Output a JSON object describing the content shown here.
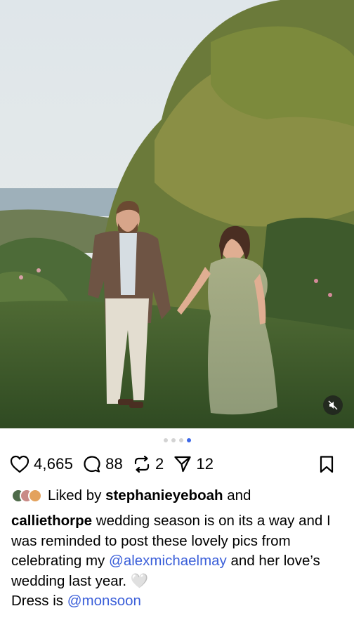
{
  "post": {
    "carousel": {
      "total": 4,
      "active_index": 3
    },
    "media": {
      "mute_icon": "speaker-muted-icon"
    },
    "actions": {
      "likes": "4,665",
      "comments": "88",
      "reposts": "2",
      "shares": "12"
    },
    "liked_by": {
      "prefix": "Liked by",
      "user": "stephanieyeboah",
      "suffix": "and"
    },
    "caption": {
      "username": "calliethorpe",
      "text_1": "wedding season is on its a way and I was reminded to post these lovely pics from celebrating my",
      "mention_1": "@alexmichaelmay",
      "text_2": "and her love’s wedding last year. 🤍",
      "text_3": "Dress is",
      "mention_2": "@monsoon"
    }
  },
  "colors": {
    "mention": "#3b5fd9",
    "carousel_active": "#3b67e8",
    "carousel_inactive": "#d3d3d3"
  }
}
